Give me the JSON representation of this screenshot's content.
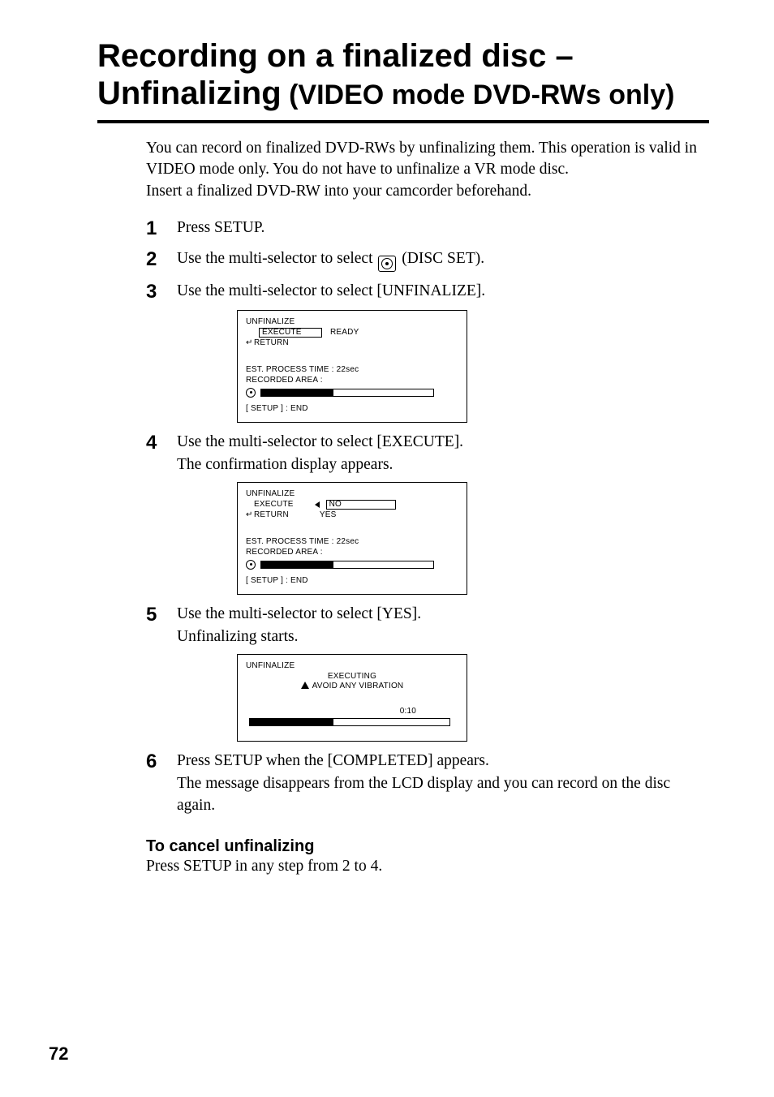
{
  "title": {
    "line1": "Recording on a finalized disc –",
    "line2_strong": "Unfinalizing",
    "line2_rest": " (VIDEO mode DVD-RWs only)"
  },
  "intro": {
    "p1a": "You can record on finalized DVD-RWs by unfinalizing them. This operation is valid in",
    "p1b": "VIDEO mode only. You do not have to unfinalize a VR mode disc.",
    "p1c": "Insert a finalized DVD-RW into your camcorder beforehand."
  },
  "steps": {
    "s1": {
      "num": "1",
      "text": "Press SETUP."
    },
    "s2": {
      "num": "2",
      "text_a": "Use the multi-selector to select ",
      "text_b": " (DISC SET)."
    },
    "s3": {
      "num": "3",
      "text": "Use the multi-selector to select [UNFINALIZE]."
    },
    "s4": {
      "num": "4",
      "text1": "Use the multi-selector to select [EXECUTE].",
      "text2": "The confirmation display appears."
    },
    "s5": {
      "num": "5",
      "text1": "Use the multi-selector to select [YES].",
      "text2": "Unfinalizing starts."
    },
    "s6": {
      "num": "6",
      "text1": "Press SETUP when the [COMPLETED] appears.",
      "text2": "The message disappears from the LCD display and you can record on the disc again."
    }
  },
  "screens": {
    "a": {
      "header": "UNFINALIZE",
      "execute": "EXECUTE",
      "ready": "READY",
      "return": "RETURN",
      "est": "EST. PROCESS TIME : 22sec",
      "rec": "RECORDED AREA :",
      "fill_pct": 42,
      "end": "[ SETUP ] : END"
    },
    "b": {
      "header": "UNFINALIZE",
      "execute": "EXECUTE",
      "return": "RETURN",
      "no": "NO",
      "yes": "YES",
      "est": "EST. PROCESS TIME : 22sec",
      "rec": "RECORDED AREA :",
      "fill_pct": 42,
      "end": "[ SETUP ] : END"
    },
    "c": {
      "header": "UNFINALIZE",
      "executing": "EXECUTING",
      "avoid": "AVOID  ANY  VIBRATION",
      "time": "0:10",
      "fill_pct": 42
    }
  },
  "cancel": {
    "head": "To cancel unfinalizing",
    "text": "Press SETUP in any step from 2 to 4."
  },
  "page_number": "72"
}
